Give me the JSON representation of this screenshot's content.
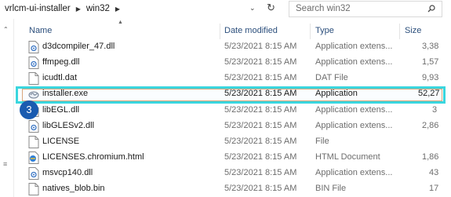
{
  "breadcrumb": {
    "items": [
      "vrlcm-ui-installer",
      "win32"
    ]
  },
  "search": {
    "placeholder": "Search win32"
  },
  "columns": {
    "name": "Name",
    "date": "Date modified",
    "type": "Type",
    "size": "Size"
  },
  "badge": {
    "number": "3"
  },
  "files": [
    {
      "name": "d3dcompiler_47.dll",
      "date": "5/23/2021 8:15 AM",
      "type": "Application extens...",
      "size": "3,38",
      "icon": "dll-file-icon"
    },
    {
      "name": "ffmpeg.dll",
      "date": "5/23/2021 8:15 AM",
      "type": "Application extens...",
      "size": "1,57",
      "icon": "dll-file-icon"
    },
    {
      "name": "icudtl.dat",
      "date": "5/23/2021 8:15 AM",
      "type": "DAT File",
      "size": "9,93",
      "icon": "blank-file-icon"
    },
    {
      "name": "installer.exe",
      "date": "5/23/2021 8:15 AM",
      "type": "Application",
      "size": "52,27",
      "icon": "installer-exe-icon"
    },
    {
      "name": "libEGL.dll",
      "date": "5/23/2021 8:15 AM",
      "type": "Application extens...",
      "size": "3",
      "icon": "dll-file-icon"
    },
    {
      "name": "libGLESv2.dll",
      "date": "5/23/2021 8:15 AM",
      "type": "Application extens...",
      "size": "2,86",
      "icon": "dll-file-icon"
    },
    {
      "name": "LICENSE",
      "date": "5/23/2021 8:15 AM",
      "type": "File",
      "size": "",
      "icon": "blank-file-icon"
    },
    {
      "name": "LICENSES.chromium.html",
      "date": "5/23/2021 8:15 AM",
      "type": "HTML Document",
      "size": "1,86",
      "icon": "html-file-icon"
    },
    {
      "name": "msvcp140.dll",
      "date": "5/23/2021 8:15 AM",
      "type": "Application extens...",
      "size": "43",
      "icon": "dll-file-icon"
    },
    {
      "name": "natives_blob.bin",
      "date": "5/23/2021 8:15 AM",
      "type": "BIN File",
      "size": "17",
      "icon": "blank-file-icon"
    }
  ],
  "colors": {
    "selection_outline": "#3ad6de",
    "badge": "#1a5bb0",
    "header_text": "#2c4f7c"
  }
}
